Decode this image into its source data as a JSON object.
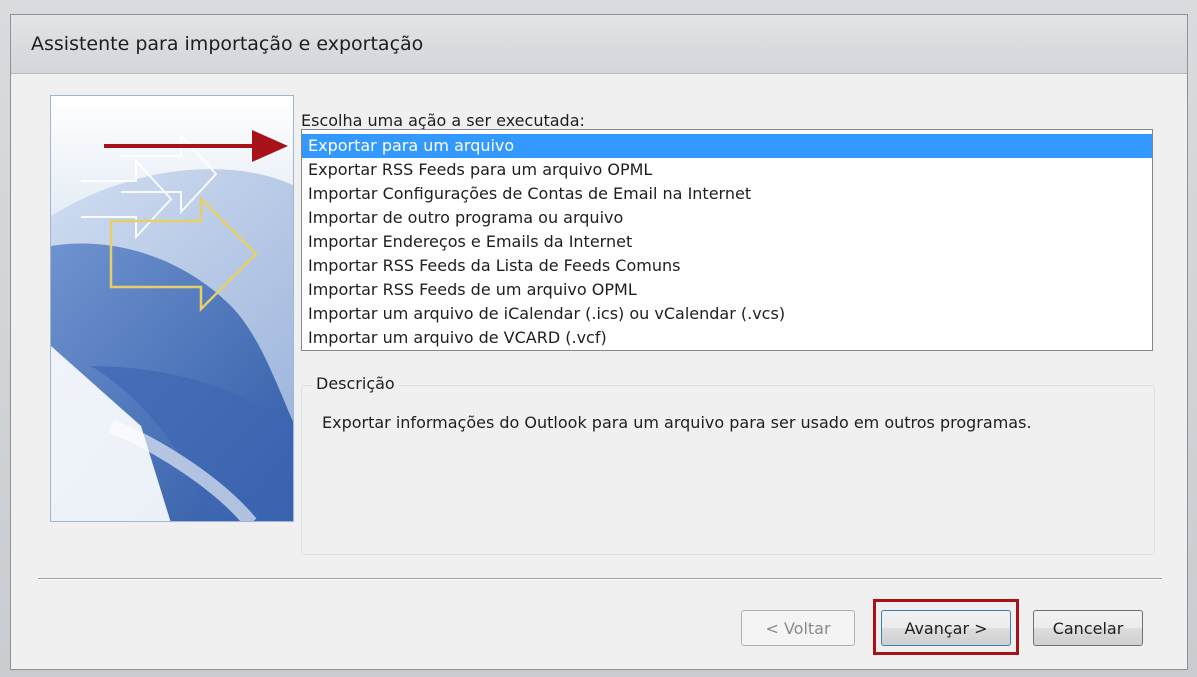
{
  "dialog": {
    "title": "Assistente para importação e exportação"
  },
  "prompt": {
    "label": "Escolha uma ação a ser executada:"
  },
  "actions": {
    "items": [
      "Exportar para um arquivo",
      "Exportar RSS Feeds para um arquivo OPML",
      "Importar Configurações de Contas de Email na Internet",
      "Importar de outro programa ou arquivo",
      "Importar Endereços e Emails da Internet",
      "Importar RSS Feeds da Lista de Feeds Comuns",
      "Importar RSS Feeds de um arquivo OPML",
      "Importar um arquivo de iCalendar (.ics) ou vCalendar (.vcs)",
      "Importar um arquivo de VCARD (.vcf)"
    ],
    "selected_index": 0
  },
  "description": {
    "legend": "Descrição",
    "text": "Exportar informações do Outlook para um arquivo para ser usado em outros programas."
  },
  "buttons": {
    "back": "< Voltar",
    "next": "Avançar >",
    "cancel": "Cancelar"
  },
  "colors": {
    "selection": "#3399ff",
    "annotation_red": "#a8131a"
  }
}
